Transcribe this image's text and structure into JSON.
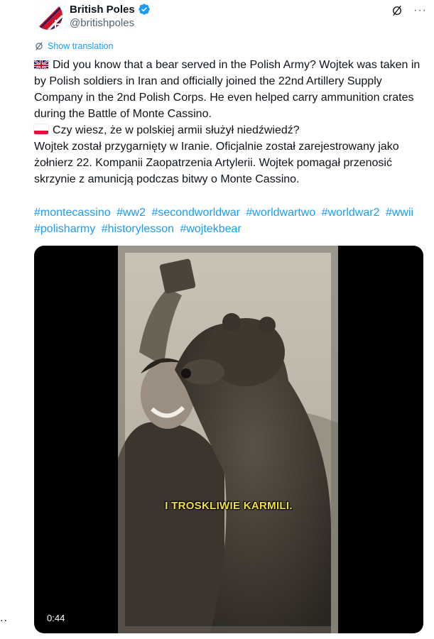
{
  "author": {
    "display_name": "British Poles",
    "handle": "@britishpoles",
    "verified": true,
    "avatar_icon": "british-poles-logo"
  },
  "actions": {
    "grok_icon": "grok-icon",
    "more_label": "···"
  },
  "translation": {
    "label": "Show translation"
  },
  "tweet": {
    "en_text": "Did you know that a bear served in the Polish Army? Wojtek was taken in by Polish soldiers in Iran and officially joined the 22nd Artillery Supply Company in the 2nd Polish Corps. He even helped carry ammunition crates during the Battle of Monte Cassino.",
    "pl_line1": "Czy wiesz, że w polskiej armii służył niedźwiedź?",
    "pl_text": "Wojtek został przygarnięty w Iranie. Oficjalnie został zarejestrowany jako żołnierz 22. Kompanii Zaopatrzenia Artylerii. Wojtek pomagał przenosić skrzynie z amunicją podczas bitwy o Monte Cassino.",
    "hashtags": [
      "#montecassino",
      "#ww2",
      "#secondworldwar",
      "#worldwartwo",
      "#worldwar2",
      "#wwii",
      "#polisharmy",
      "#historylesson",
      "#wojtekbear"
    ]
  },
  "video": {
    "caption": "I TROSKLIWIE KARMILI.",
    "duration": "0:44"
  },
  "sidebar": {
    "dots": ".."
  },
  "colors": {
    "link": "#1d9bf0",
    "text": "#0f1419",
    "muted": "#536471",
    "caption": "#f3e13a"
  }
}
